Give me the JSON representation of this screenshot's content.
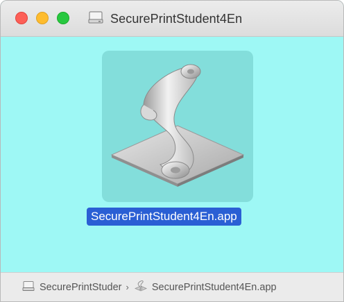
{
  "window": {
    "title": "SecurePrintStudent4En",
    "title_icon": "disk-icon"
  },
  "content": {
    "file_name": "SecurePrintStudent4En.app",
    "file_icon": "script-app-icon",
    "selection_color": "#2a5fd4",
    "background_color": "#9ef8f5"
  },
  "pathbar": {
    "items": [
      {
        "label": "SecurePrintStuder",
        "icon": "disk-icon"
      },
      {
        "label": "SecurePrintStudent4En.app",
        "icon": "script-app-icon"
      }
    ],
    "separator": "›"
  }
}
